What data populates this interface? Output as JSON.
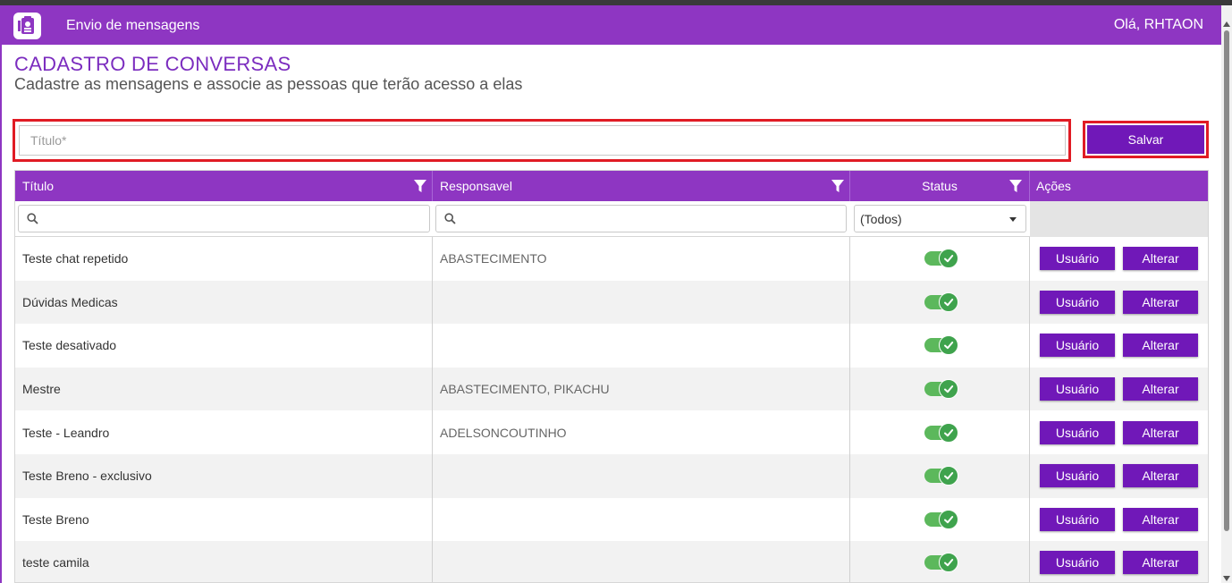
{
  "header": {
    "app_title": "Envio de mensagens",
    "greeting": "Olá, RHTAON"
  },
  "page": {
    "title": "CADASTRO DE CONVERSAS",
    "subtitle": "Cadastre as mensagens e associe as pessoas que terão acesso a elas"
  },
  "form": {
    "title_placeholder": "Título*",
    "title_value": "",
    "save_label": "Salvar"
  },
  "grid": {
    "columns": {
      "title": "Título",
      "responsavel": "Responsavel",
      "status": "Status",
      "acoes": "Ações"
    },
    "filters": {
      "title_search": "",
      "responsavel_search": "",
      "status_selected": "(Todos)"
    },
    "action_labels": {
      "user": "Usuário",
      "alter": "Alterar"
    },
    "rows": [
      {
        "title": "Teste chat repetido",
        "responsavel": "ABASTECIMENTO",
        "status": true
      },
      {
        "title": "Dúvidas Medicas",
        "responsavel": "",
        "status": true
      },
      {
        "title": "Teste desativado",
        "responsavel": "",
        "status": true
      },
      {
        "title": "Mestre",
        "responsavel": "ABASTECIMENTO, PIKACHU",
        "status": true
      },
      {
        "title": "Teste - Leandro",
        "responsavel": "ADELSONCOUTINHO",
        "status": true
      },
      {
        "title": "Teste Breno - exclusivo",
        "responsavel": "",
        "status": true
      },
      {
        "title": "Teste Breno",
        "responsavel": "",
        "status": true
      },
      {
        "title": "teste camila",
        "responsavel": "",
        "status": true
      }
    ]
  },
  "colors": {
    "brand": "#8e36c2",
    "button": "#7018b8",
    "toggle_on": "#3fa34d",
    "highlight": "#e01b24"
  },
  "icons": [
    "app-logo-icon",
    "filter-icon",
    "search-icon",
    "chevron-down-icon",
    "check-icon"
  ]
}
